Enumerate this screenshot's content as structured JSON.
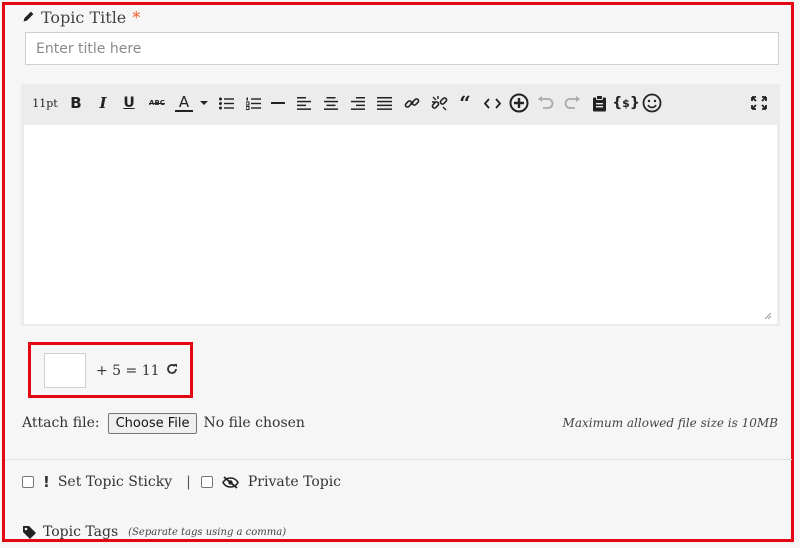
{
  "topic_title": {
    "label": "Topic Title",
    "required_mark": "*",
    "placeholder": "Enter title here"
  },
  "toolbar": {
    "font_size": "11pt",
    "bold": "B",
    "italic": "I",
    "underline": "U",
    "strikethrough": "ABC",
    "text_color": "A",
    "items": [
      "font-size",
      "bold",
      "italic",
      "underline",
      "strikethrough",
      "text-color",
      "bullet-list",
      "numbered-list",
      "horizontal-rule",
      "align-left",
      "align-center",
      "align-right",
      "justify",
      "link",
      "unlink",
      "blockquote",
      "code",
      "insert",
      "undo",
      "redo",
      "paste",
      "shortcode",
      "emoji",
      "fullscreen"
    ]
  },
  "captcha": {
    "expression": "+ 5 = 11"
  },
  "attach": {
    "label": "Attach file:",
    "button_label": "Choose File",
    "status": "No file chosen",
    "max_size_note": "Maximum allowed file size is 10MB"
  },
  "options": {
    "sticky_label": "Set Topic Sticky",
    "separator": "|",
    "private_label": "Private Topic"
  },
  "tags": {
    "label": "Topic Tags",
    "note": "(Separate tags using a comma)"
  },
  "colors": {
    "highlight_border": "#e30613",
    "required": "#f05a28",
    "toolbar_bg": "#ececec"
  }
}
